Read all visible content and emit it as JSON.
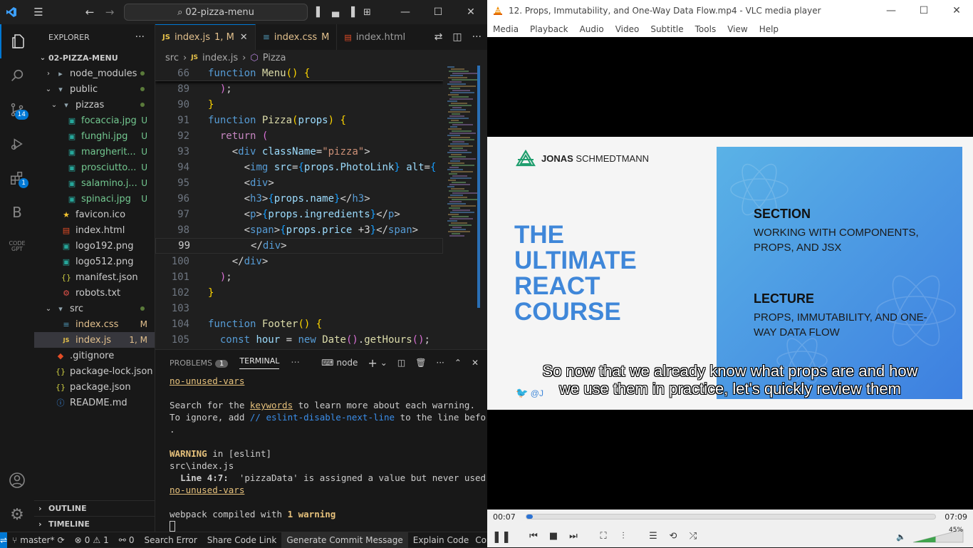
{
  "vscode": {
    "command_center": "02-pizza-menu",
    "explorer_title": "EXPLORER",
    "root_folder": "02-PIZZA-MENU",
    "tree": [
      {
        "label": "node_modules",
        "indent": 1,
        "type": "folder-closed",
        "status": "dot"
      },
      {
        "label": "public",
        "indent": 1,
        "type": "folder-open",
        "status": "dot"
      },
      {
        "label": "pizzas",
        "indent": 2,
        "type": "folder-open",
        "status": "dot"
      },
      {
        "label": "focaccia.jpg",
        "indent": 3,
        "type": "image",
        "status": "U"
      },
      {
        "label": "funghi.jpg",
        "indent": 3,
        "type": "image",
        "status": "U"
      },
      {
        "label": "margherit...",
        "indent": 3,
        "type": "image",
        "status": "U"
      },
      {
        "label": "prosciutto...",
        "indent": 3,
        "type": "image",
        "status": "U"
      },
      {
        "label": "salamino.j...",
        "indent": 3,
        "type": "image",
        "status": "U"
      },
      {
        "label": "spinaci.jpg",
        "indent": 3,
        "type": "image",
        "status": "U"
      },
      {
        "label": "favicon.ico",
        "indent": 2,
        "type": "star",
        "status": ""
      },
      {
        "label": "index.html",
        "indent": 2,
        "type": "html",
        "status": ""
      },
      {
        "label": "logo192.png",
        "indent": 2,
        "type": "image",
        "status": ""
      },
      {
        "label": "logo512.png",
        "indent": 2,
        "type": "image",
        "status": ""
      },
      {
        "label": "manifest.json",
        "indent": 2,
        "type": "json",
        "status": ""
      },
      {
        "label": "robots.txt",
        "indent": 2,
        "type": "robot",
        "status": ""
      },
      {
        "label": "src",
        "indent": 1,
        "type": "folder-open",
        "status": "dot"
      },
      {
        "label": "index.css",
        "indent": 2,
        "type": "css",
        "status": "M"
      },
      {
        "label": "index.js",
        "indent": 2,
        "type": "js",
        "status": "1, M"
      },
      {
        "label": ".gitignore",
        "indent": 1,
        "type": "git",
        "status": ""
      },
      {
        "label": "package-lock.json",
        "indent": 1,
        "type": "json",
        "status": ""
      },
      {
        "label": "package.json",
        "indent": 1,
        "type": "json",
        "status": ""
      },
      {
        "label": "README.md",
        "indent": 1,
        "type": "info",
        "status": ""
      }
    ],
    "outline_label": "OUTLINE",
    "timeline_label": "TIMELINE",
    "tabs": [
      {
        "label": "index.js",
        "badge": "1, M",
        "icon": "JS",
        "active": true
      },
      {
        "label": "index.css",
        "badge": "M",
        "icon": "CSS",
        "active": false
      },
      {
        "label": "index.html",
        "badge": "",
        "icon": "HTML",
        "active": false
      }
    ],
    "breadcrumbs": [
      "src",
      "index.js",
      "Pizza"
    ],
    "source_control_badge": "14",
    "extensions_badge": "1",
    "code_lines": [
      {
        "n": "66",
        "html": "<span class='kw'>function</span> <span class='fn'>Menu</span><span class='br2'>()</span> <span class='br2'>{</span>"
      },
      {
        "n": "89",
        "html": "  <span class='br'>)</span>;"
      },
      {
        "n": "90",
        "html": "<span class='br2'>}</span>"
      },
      {
        "n": "91",
        "html": "<span class='kw'>function</span> <span class='fn'>Pizza</span><span class='br2'>(</span><span class='ob'>props</span><span class='br2'>)</span> <span class='br2'>{</span>"
      },
      {
        "n": "92",
        "html": "  <span class='kw2'>return</span> <span class='br'>(</span>"
      },
      {
        "n": "93",
        "html": "    <span class='pl'>&lt;</span><span class='tg'>div</span> <span class='at'>className</span><span class='pl'>=</span><span class='str'>\"pizza\"</span><span class='pl'>&gt;</span>"
      },
      {
        "n": "94",
        "html": "      <span class='pl'>&lt;</span><span class='tg'>img</span> <span class='at'>src</span><span class='pl'>=</span><span class='br3'>{</span><span class='ob'>props.PhotoLink</span><span class='br3'>}</span> <span class='at'>alt</span><span class='pl'>=</span><span class='br3'>{</span>"
      },
      {
        "n": "95",
        "html": "      <span class='pl'>&lt;</span><span class='tg'>div</span><span class='pl'>&gt;</span>"
      },
      {
        "n": "96",
        "html": "      <span class='pl'>&lt;</span><span class='tg'>h3</span><span class='pl'>&gt;</span><span class='br3'>{</span><span class='ob'>props.name</span><span class='br3'>}</span><span class='pl'>&lt;/</span><span class='tg'>h3</span><span class='pl'>&gt;</span>"
      },
      {
        "n": "97",
        "html": "      <span class='pl'>&lt;</span><span class='tg'>p</span><span class='pl'>&gt;</span><span class='br3'>{</span><span class='ob'>props.ingredients</span><span class='br3'>}</span><span class='pl'>&lt;/</span><span class='tg'>p</span><span class='pl'>&gt;</span>"
      },
      {
        "n": "98",
        "html": "      <span class='pl'>&lt;</span><span class='tg'>span</span><span class='pl'>&gt;</span><span class='br3'>{</span><span class='ob'>props.price</span> <span class='pl'>+3</span><span class='br3'>}</span><span class='pl'>&lt;/</span><span class='tg'>span</span><span class='pl'>&gt;</span>"
      },
      {
        "n": "99",
        "html": "       <span class='pl'>&lt;/</span><span class='tg'>div</span><span class='pl'>&gt;</span>"
      },
      {
        "n": "100",
        "html": "    <span class='pl'>&lt;/</span><span class='tg'>div</span><span class='pl'>&gt;</span>"
      },
      {
        "n": "101",
        "html": "  <span class='br'>)</span>;"
      },
      {
        "n": "102",
        "html": "<span class='br2'>}</span>"
      },
      {
        "n": "103",
        "html": ""
      },
      {
        "n": "104",
        "html": "<span class='kw'>function</span> <span class='fn'>Footer</span><span class='br2'>()</span> <span class='br2'>{</span>"
      },
      {
        "n": "105",
        "html": "  <span class='kw'>const</span> <span class='ob'>hour</span> <span class='pl'>=</span> <span class='kw'>new</span> <span class='fn'>Date</span><span class='br'>()</span>.<span class='fn'>getHours</span><span class='br'>()</span>;"
      }
    ],
    "current_line": "99",
    "panel": {
      "problems_label": "PROBLEMS",
      "problems_count": "1",
      "terminal_label": "TERMINAL",
      "shell_label": "node"
    },
    "terminal_lines": [
      {
        "html": "<span class='u-yel'>no-unused-vars</span>"
      },
      {
        "html": ""
      },
      {
        "html": "Search for the <span class='u-yel'>keywords</span> to learn more about each warning."
      },
      {
        "html": "To ignore, add <span class='link'>// eslint-disable-next-line</span> to the line before"
      },
      {
        "html": "."
      },
      {
        "html": ""
      },
      {
        "html": "<span class='warnw'>WARNING</span> in [eslint]"
      },
      {
        "html": "src\\index.js"
      },
      {
        "html": "  <b>Line 4:7:</b>  'pizzaData' is assigned a value but never used"
      },
      {
        "html": "<span class='u-yel'>no-unused-vars</span>"
      },
      {
        "html": ""
      },
      {
        "html": "webpack compiled with <span class='warnw'>1 warning</span>"
      }
    ],
    "statusbar": {
      "branch": "master*",
      "errors": "0",
      "warnings": "1",
      "ports": "0",
      "search_error": "Search Error",
      "share": "Share Code Link",
      "commit": "Generate Commit Message",
      "explain": "Explain Code",
      "cor": "Cor"
    }
  },
  "vlc": {
    "title": "12. Props, Immutability, and One-Way Data Flow.mp4 - VLC media player",
    "menu": [
      "Media",
      "Playback",
      "Audio",
      "Video",
      "Subtitle",
      "Tools",
      "View",
      "Help"
    ],
    "slide": {
      "brand_bold": "JONAS",
      "brand_rest": "SCHMEDTMANN",
      "title_lines": [
        "THE",
        "ULTIMATE",
        "REACT",
        "COURSE"
      ],
      "section_heading": "SECTION",
      "section_text": "WORKING WITH COMPONENTS, PROPS, AND JSX",
      "lecture_heading": "LECTURE",
      "lecture_text": "PROPS, IMMUTABILITY, AND ONE-WAY DATA FLOW",
      "twitter": "@J"
    },
    "subtitle_lines": [
      "So now that we already know what props are and how",
      "we use them in practice, let's quickly review them"
    ],
    "time_elapsed": "00:07",
    "time_total": "07:09",
    "progress": 0.016,
    "volume_label": "45%",
    "volume": 0.45
  }
}
